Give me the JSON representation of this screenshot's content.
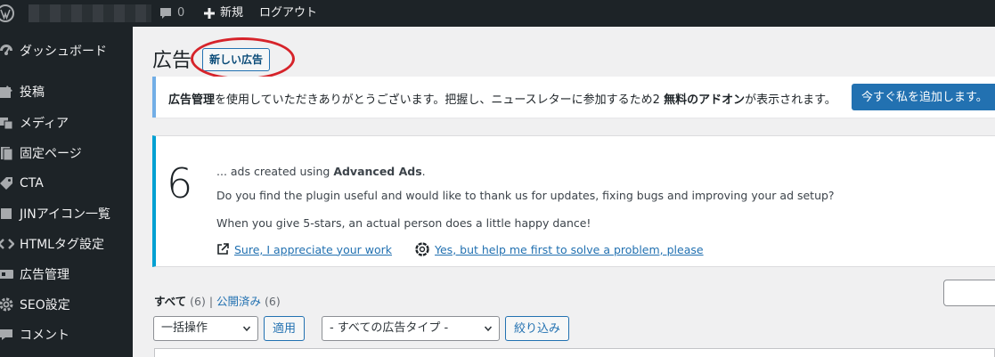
{
  "adminbar": {
    "comment_count": "0",
    "new_label": "新規",
    "logout_label": "ログアウト"
  },
  "sidebar": {
    "items": [
      {
        "label": "ダッシュボード",
        "icon": "dashboard-icon"
      },
      {
        "label": "投稿",
        "icon": "pin-icon"
      },
      {
        "label": "メディア",
        "icon": "media-icon"
      },
      {
        "label": "固定ページ",
        "icon": "page-icon"
      },
      {
        "label": "CTA",
        "icon": "tag-icon"
      },
      {
        "label": "JINアイコン一覧",
        "icon": "list-icon"
      },
      {
        "label": "HTMLタグ設定",
        "icon": "code-icon"
      },
      {
        "label": "広告管理",
        "icon": "ads-icon"
      },
      {
        "label": "SEO設定",
        "icon": "gear-icon"
      },
      {
        "label": "コメント",
        "icon": "comment-icon"
      }
    ]
  },
  "page": {
    "title": "広告",
    "new_button": "新しい広告"
  },
  "notice": {
    "bold1": "広告管理",
    "text1": "を使用していただきありがとうございます。把握し、ニュースレターに参加するため2 ",
    "bold2": "無料のアドオン",
    "text2": "が表示されます。",
    "button": "今すぐ私を追加します。"
  },
  "review": {
    "count": "6",
    "line1_prefix": "... ads created using ",
    "line1_bold": "Advanced Ads",
    "line1_suffix": ".",
    "line2": "Do you find the plugin useful and would like to thank us for updates, fixing bugs and improving your ad setup?",
    "line3": "When you give 5-stars, an actual person does a little happy dance!",
    "link1": "Sure, I appreciate your work",
    "link2": "Yes, but help me first to solve a problem, please"
  },
  "filters": {
    "all_label": "すべて",
    "all_count": "(6)",
    "separator": "|",
    "published_label": "公開済み",
    "published_count": "(6)"
  },
  "actions": {
    "bulk_select": "一括操作",
    "apply_button": "適用",
    "type_select": "- すべての広告タイプ -",
    "filter_button": "絞り込み"
  },
  "colors": {
    "sidebar_bg": "#1d2327",
    "primary": "#2271b1",
    "notice_border": "#72aee6",
    "review_border": "#00a0d2",
    "highlight": "#d6232a"
  }
}
